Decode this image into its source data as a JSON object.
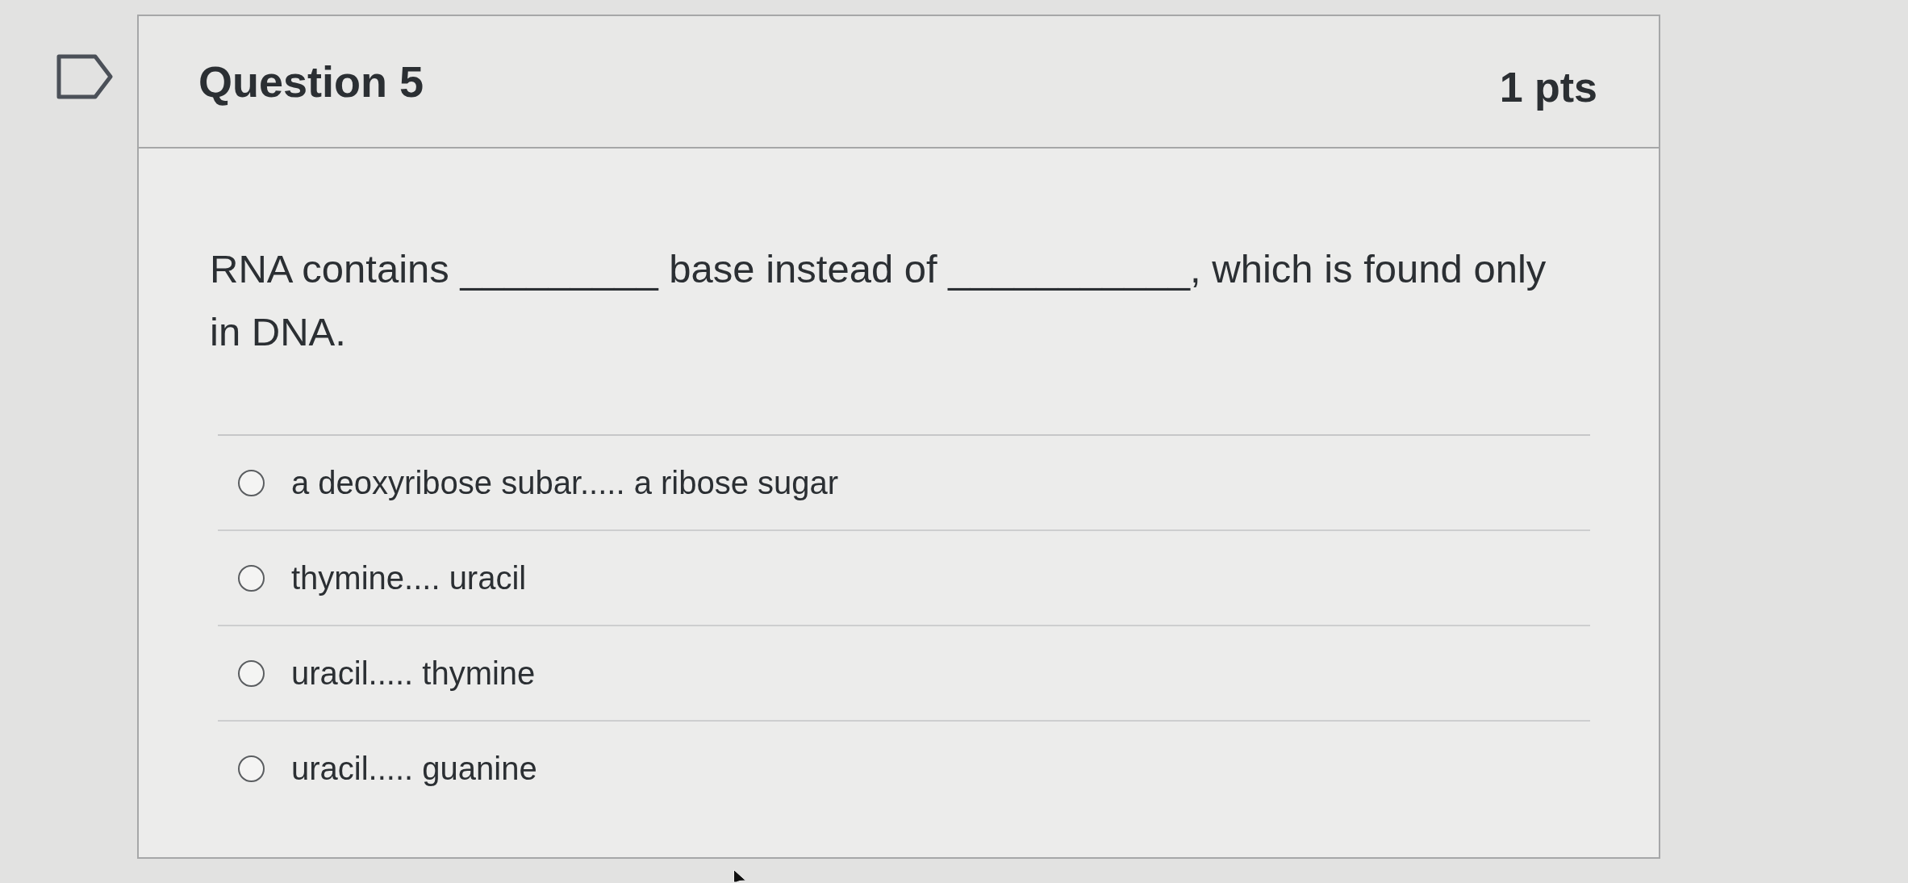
{
  "question": {
    "flagged": false,
    "title": "Question 5",
    "points": "1 pts",
    "text": "RNA contains _________ base instead of ___________, which is found only in DNA.",
    "answers": [
      {
        "label": "a deoxyribose subar..... a ribose sugar",
        "selected": false
      },
      {
        "label": "thymine.... uracil",
        "selected": false
      },
      {
        "label": "uracil..... thymine",
        "selected": false
      },
      {
        "label": "uracil..... guanine",
        "selected": false
      }
    ]
  }
}
